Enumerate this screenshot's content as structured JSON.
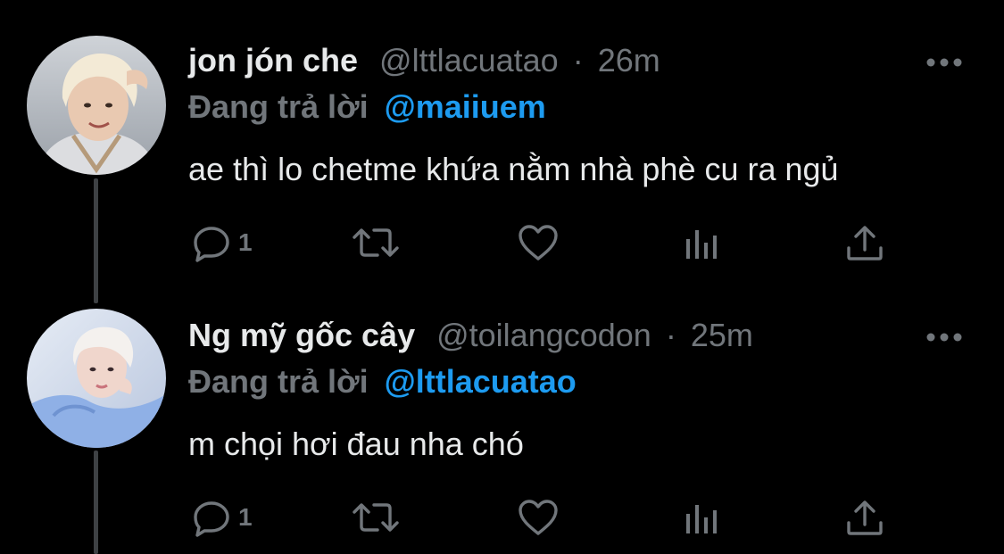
{
  "colors": {
    "background": "#000000",
    "text": "#e7e9ea",
    "secondary": "#71767b",
    "accent": "#1d9bf0",
    "thread_line": "#3e4144"
  },
  "tweets": [
    {
      "display_name": "jon jón che",
      "handle": "@lttlacuatao",
      "separator": "·",
      "time": "26m",
      "reply_prefix": "Đang trả lời",
      "reply_to": "@maiiuem",
      "text": "ae thì lo chetme khứa nằm nhà phè cu ra ngủ",
      "reply_count": "1",
      "icons": [
        "more-icon",
        "reply-icon",
        "retweet-icon",
        "like-icon",
        "analytics-icon",
        "share-icon"
      ]
    },
    {
      "display_name": "Ng mỹ gốc cây",
      "handle": "@toilangcodon",
      "separator": "·",
      "time": "25m",
      "reply_prefix": "Đang trả lời",
      "reply_to": "@lttlacuatao",
      "text": "m chọi hơi đau nha chó",
      "reply_count": "1",
      "icons": [
        "more-icon",
        "reply-icon",
        "retweet-icon",
        "like-icon",
        "analytics-icon",
        "share-icon"
      ]
    }
  ]
}
